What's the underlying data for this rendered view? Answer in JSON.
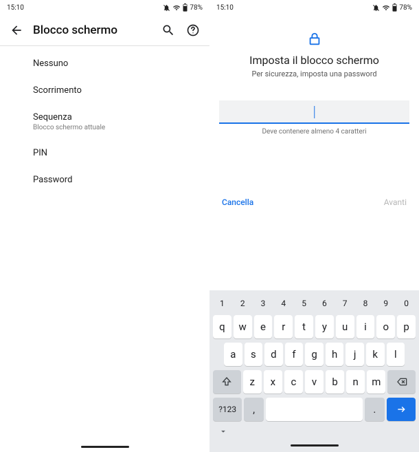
{
  "status": {
    "time": "15:10",
    "battery": "78%"
  },
  "left": {
    "app_title": "Blocco schermo",
    "options": [
      {
        "label": "Nessuno",
        "sub": ""
      },
      {
        "label": "Scorrimento",
        "sub": ""
      },
      {
        "label": "Sequenza",
        "sub": "Blocco schermo attuale"
      },
      {
        "label": "PIN",
        "sub": ""
      },
      {
        "label": "Password",
        "sub": ""
      }
    ]
  },
  "right": {
    "title": "Imposta il blocco schermo",
    "subtitle": "Per sicurezza, imposta una password",
    "hint": "Deve contenere almeno 4 caratteri",
    "cancel": "Cancella",
    "next": "Avanti",
    "password_value": ""
  },
  "keyboard": {
    "row_nums": [
      "1",
      "2",
      "3",
      "4",
      "5",
      "6",
      "7",
      "8",
      "9",
      "0"
    ],
    "row1": [
      "q",
      "w",
      "e",
      "r",
      "t",
      "y",
      "u",
      "i",
      "o",
      "p"
    ],
    "row2": [
      "a",
      "s",
      "d",
      "f",
      "g",
      "h",
      "j",
      "k",
      "l"
    ],
    "row3": [
      "z",
      "x",
      "c",
      "v",
      "b",
      "n",
      "m"
    ],
    "symkey": "?123",
    "comma": ",",
    "period": "."
  }
}
